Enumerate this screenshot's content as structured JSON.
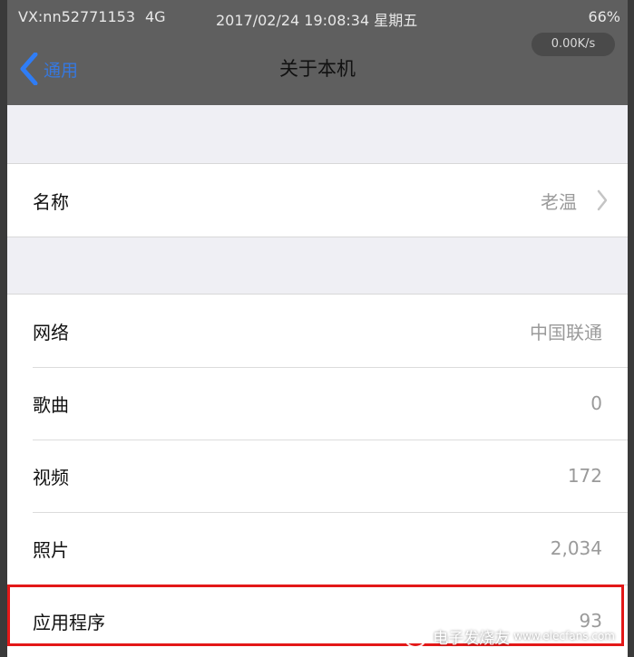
{
  "status_bar": {
    "carrier": "VX:nn52771153",
    "network": "4G",
    "datetime": "2017/02/24 19:08:34 星期五",
    "battery": "66%"
  },
  "nav": {
    "speed": "0.00K/s",
    "back_label": "通用",
    "title": "关于本机"
  },
  "name_row": {
    "label": "名称",
    "value": "老温"
  },
  "info_rows": [
    {
      "label": "网络",
      "value": "中国联通"
    },
    {
      "label": "歌曲",
      "value": "0"
    },
    {
      "label": "视频",
      "value": "172"
    },
    {
      "label": "照片",
      "value": "2,034"
    },
    {
      "label": "应用程序",
      "value": "93"
    }
  ],
  "watermark": {
    "text": "电子发烧友",
    "url": "www.elecfans.com"
  },
  "colors": {
    "highlight": "#e31818",
    "link": "#2f7df6"
  }
}
